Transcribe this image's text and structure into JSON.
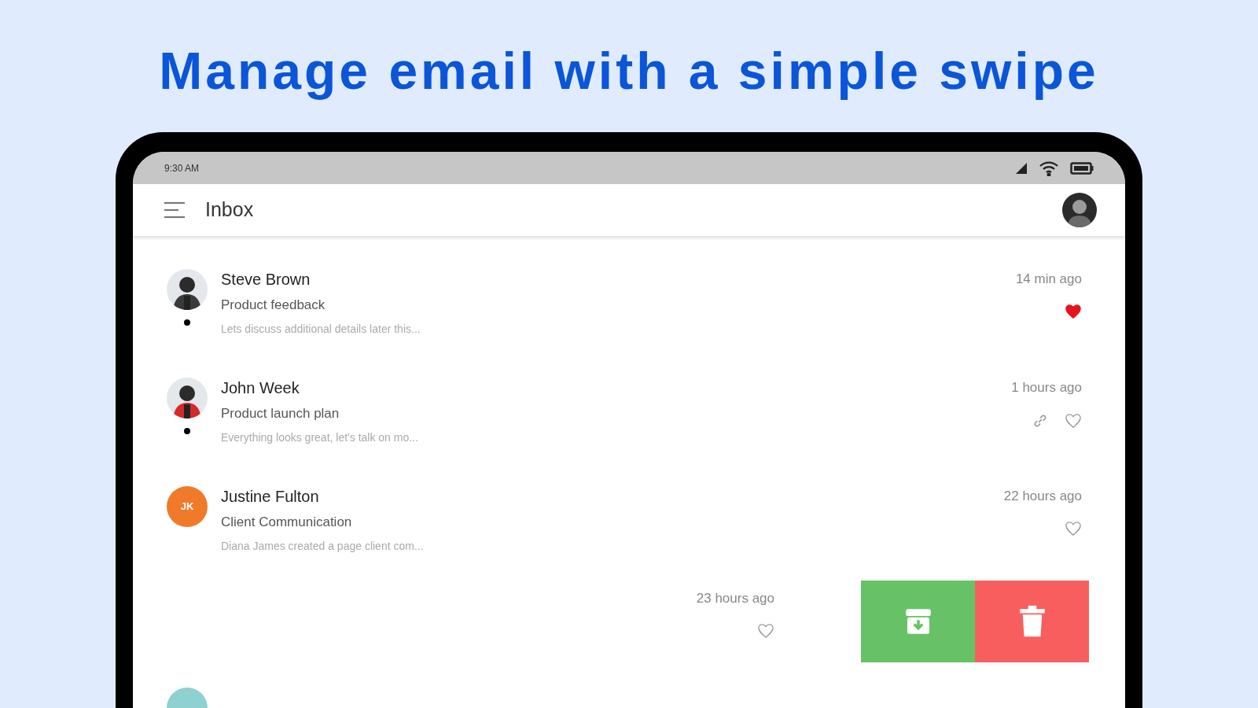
{
  "headline": "Manage email with a simple swipe",
  "status_bar": {
    "time": "9:30 AM"
  },
  "app_bar": {
    "title": "Inbox"
  },
  "messages": [
    {
      "kind": "message",
      "sender": "Steve Brown",
      "subject": "Product feedback",
      "preview": "Lets discuss additional details later this...",
      "time": "14 min ago",
      "unread": true,
      "favorite": true,
      "attachment": false
    },
    {
      "kind": "message",
      "sender": "John Week",
      "subject": "Product launch plan",
      "preview": "Everything looks great, let's talk on mo...",
      "time": "1 hours ago",
      "unread": true,
      "favorite": false,
      "attachment": true
    },
    {
      "kind": "message",
      "avatar": {
        "kind": "initials",
        "initials": "JK",
        "color": "#f07a2a"
      },
      "sender": "Justine Fulton",
      "subject": "Client Communication",
      "preview": "Diana James created a page client com...",
      "time": "22 hours ago",
      "unread": false,
      "favorite": false,
      "attachment": false
    },
    {
      "kind": "swiped",
      "time": "23 hours ago",
      "favorite": false,
      "actions": [
        {
          "kind": "archive"
        },
        {
          "kind": "delete"
        }
      ]
    },
    {
      "kind": "partial",
      "avatar": {
        "kind": "blank",
        "color": "#8fd0d0"
      }
    }
  ]
}
